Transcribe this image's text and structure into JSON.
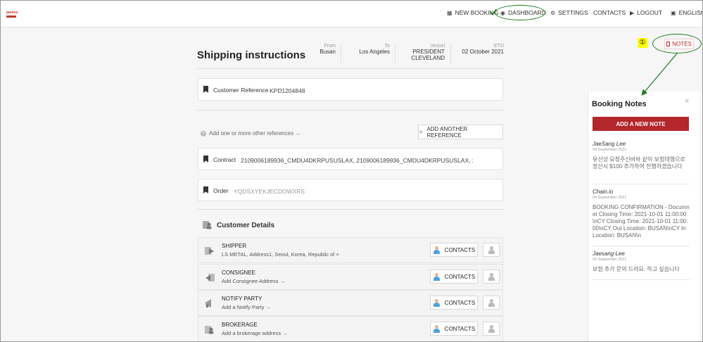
{
  "brand": {
    "logo_text": "pantos"
  },
  "nav": {
    "items": [
      {
        "label": "NEW BOOKING",
        "icon": "clipboard-icon"
      },
      {
        "label": "DASHBOARD",
        "icon": "dashboard-icon"
      },
      {
        "label": "SETTINGS",
        "icon": "gear-icon"
      },
      {
        "label": "CONTACTS",
        "icon": ""
      },
      {
        "label": "LOGOUT",
        "icon": "logout-icon"
      },
      {
        "label": "ENGLISH",
        "icon": "book-icon"
      }
    ]
  },
  "page": {
    "title": "Shipping instructions",
    "route": {
      "from_label": "From",
      "from": "Busan",
      "to_label": "To",
      "to": "Los Angeles",
      "vessel_label": "Vessel",
      "vessel_line1": "PRESIDENT",
      "vessel_line2": "CLEVELAND",
      "etd_label": "ETD",
      "etd": "02 October 2021"
    },
    "customer_reference": {
      "label": "Customer Reference",
      "value": "KPD1204848"
    },
    "add_reference_text": "Add one or more other references →",
    "add_reference_button": "ADD ANOTHER REFERENCE",
    "contract": {
      "label": "Contract",
      "value": "2109006189936_CMDU4DKRPUSUSLAX, 2109006189936_CMDU4DKRPUSUSLAX, 210900..."
    },
    "order": {
      "label": "Order",
      "value": "YQDSXYEKJECDOWXRS"
    },
    "customer_details_title": "Customer Details",
    "parties": [
      {
        "name": "SHIPPER",
        "sub": "LS METAL, Address1, Seoul, Korea, Republic of ×",
        "contacts": "CONTACTS"
      },
      {
        "name": "CONSIGNEE",
        "sub": "Add Consignee Address →",
        "contacts": "CONTACTS"
      },
      {
        "name": "NOTIFY PARTY",
        "sub": "Add a Notify Party →",
        "contacts": "CONTACTS"
      },
      {
        "name": "BROKERAGE",
        "sub": "Add a brokerage address →",
        "contacts": "CONTACTS"
      }
    ]
  },
  "annotation": {
    "marker": "①"
  },
  "notes_button": "NOTES",
  "booking_notes": {
    "title": "Booking Notes",
    "close": "×",
    "add_button": "ADD A NEW NOTE",
    "notes": [
      {
        "author": "JaeSang Lee",
        "date": "04 September 2021",
        "text": "유선상 요청주신바와 같이 보험대행으로 정산시 $100 추가하여 진행하겠습니다"
      },
      {
        "author": "Chain.io",
        "date": "04 September 2021",
        "text": "BOOKING CONFIRMATION - Documnet Closing Time: 2021-10-01 11:00:00\\nCY Closing Time: 2021-10-01 11:00:00\\nCY Out Location: BUSAN\\nCY In Location: BUSAN\\n"
      },
      {
        "author": "Jaesang Lee",
        "date": "03 September 2021",
        "text": "보험 추가 문의 드려요. 하고 싶습니다"
      }
    ]
  },
  "colors": {
    "accent": "#b3262b",
    "annotation": "#1a7a1a",
    "highlight": "#ffff00"
  }
}
